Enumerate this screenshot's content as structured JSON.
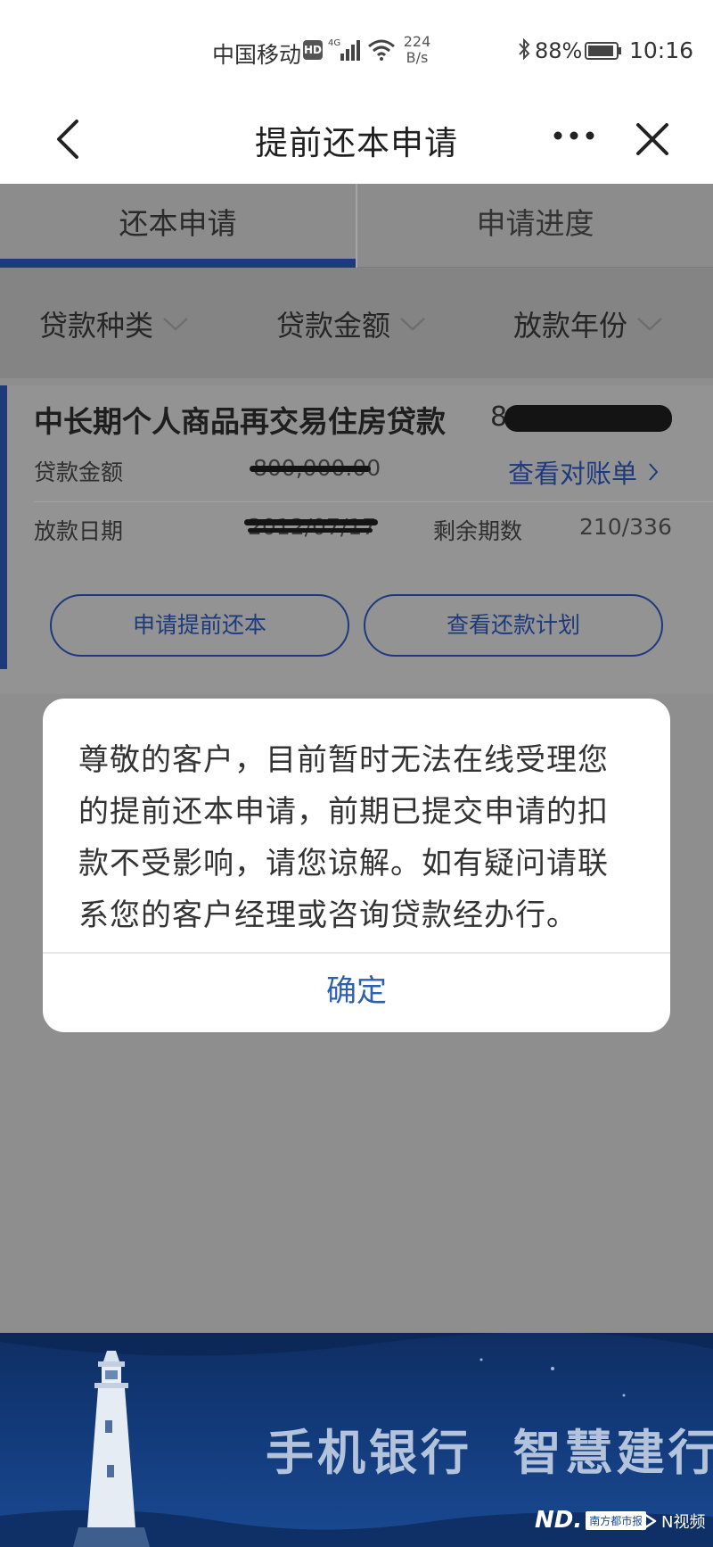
{
  "status_bar": {
    "carrier": "中国移动",
    "hd": "HD",
    "network": "4G",
    "net_speed_value": "224",
    "net_speed_unit": "B/s",
    "battery": "88%",
    "time": "10:16"
  },
  "nav": {
    "title": "提前还本申请",
    "back_icon": "chevron-left-icon",
    "more_icon": "more-dots-icon",
    "close_icon": "close-icon"
  },
  "tabs": [
    {
      "label": "还本申请",
      "active": true
    },
    {
      "label": "申请进度",
      "active": false
    }
  ],
  "filters": [
    {
      "label": "贷款种类"
    },
    {
      "label": "贷款金额"
    },
    {
      "label": "放款年份"
    }
  ],
  "loan": {
    "name": "中长期个人商品再交易住房贷款",
    "number_visible": "8",
    "amount_label": "贷款金额",
    "amount_value": "800,000.00",
    "statement_link": "查看对账单",
    "date_label": "放款日期",
    "date_value": "2012/07/17",
    "remaining_label": "剩余期数",
    "remaining_value": "210/336",
    "btn_prepay": "申请提前还本",
    "btn_plan": "查看还款计划"
  },
  "modal": {
    "message": "尊敬的客户，目前暂时无法在线受理您的提前还本申请，前期已提交申请的扣款不受影响，请您谅解。如有疑问请联系您的客户经理或咨询贷款经办行。",
    "confirm": "确定"
  },
  "banner": {
    "slogan": "手机银行  智慧建行"
  },
  "watermark": {
    "nd_mark": "ND.",
    "nd_name": "南方都市报",
    "video": "N视频"
  },
  "colors": {
    "accent_blue": "#1e3a7c",
    "confirm_blue": "#2d61b0",
    "overlay_gray": "#8e8e8e"
  }
}
